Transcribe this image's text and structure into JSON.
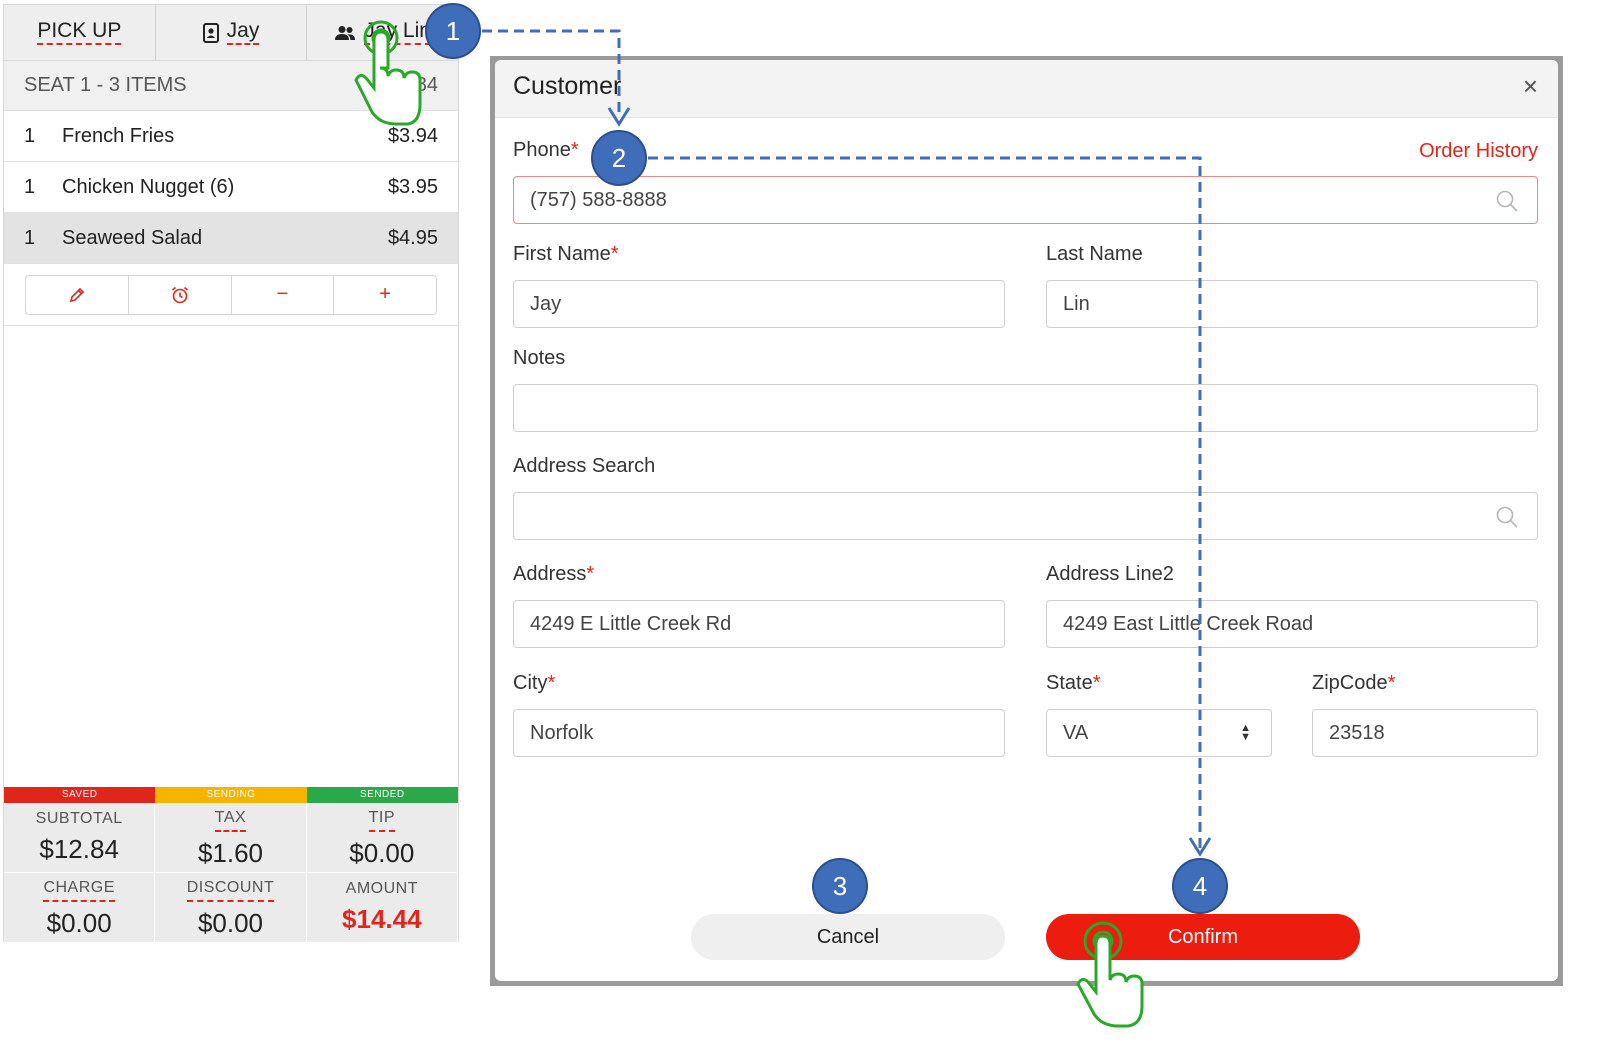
{
  "pos": {
    "tabs": [
      {
        "label": "PICK UP",
        "icon": "none"
      },
      {
        "label": "Jay",
        "icon": "phone-contact-icon"
      },
      {
        "label": "Jay Lin",
        "icon": "people-icon"
      }
    ],
    "seat_header": {
      "label": "SEAT 1 - 3 ITEMS",
      "total": "$12.84"
    },
    "items": [
      {
        "qty": "1",
        "name": "French Fries",
        "price": "$3.94"
      },
      {
        "qty": "1",
        "name": "Chicken Nugget (6)",
        "price": "$3.95"
      },
      {
        "qty": "1",
        "name": "Seaweed Salad",
        "price": "$4.95"
      }
    ],
    "actions": {
      "edit": "✎",
      "timer": "⏰",
      "minus": "−",
      "plus": "+"
    },
    "status": [
      {
        "label": "SAVED",
        "color": "#e0251b"
      },
      {
        "label": "SENDING",
        "color": "#f5b400"
      },
      {
        "label": "SENDED",
        "color": "#2aa84a"
      }
    ],
    "totals": [
      {
        "label": "SUBTOTAL",
        "value": "$12.84"
      },
      {
        "label": "TAX",
        "value": "$1.60"
      },
      {
        "label": "TIP",
        "value": "$0.00"
      },
      {
        "label": "CHARGE",
        "value": "$0.00"
      },
      {
        "label": "DISCOUNT",
        "value": "$0.00"
      },
      {
        "label": "AMOUNT",
        "value": "$14.44"
      }
    ]
  },
  "dialog": {
    "title": "Customer",
    "close": "×",
    "order_history": "Order History",
    "phone": {
      "label": "Phone",
      "value": "(757) 588-8888"
    },
    "first_name": {
      "label": "First Name",
      "value": "Jay"
    },
    "last_name": {
      "label": "Last Name",
      "value": "Lin"
    },
    "notes": {
      "label": "Notes",
      "value": ""
    },
    "address_search": {
      "label": "Address Search",
      "value": ""
    },
    "address": {
      "label": "Address",
      "value": "4249 E Little Creek Rd"
    },
    "address_line2": {
      "label": "Address Line2",
      "value": "4249 East Little Creek Road"
    },
    "city": {
      "label": "City",
      "value": "Norfolk"
    },
    "state": {
      "label": "State",
      "value": "VA"
    },
    "zipcode": {
      "label": "ZipCode",
      "value": "23518"
    },
    "required_mark": "*",
    "cancel": "Cancel",
    "confirm": "Confirm"
  },
  "steps": [
    "1",
    "2",
    "3",
    "4"
  ],
  "colors": {
    "accent": "#e0251b",
    "step": "#3f6dba",
    "hand": "#2aa82a"
  }
}
